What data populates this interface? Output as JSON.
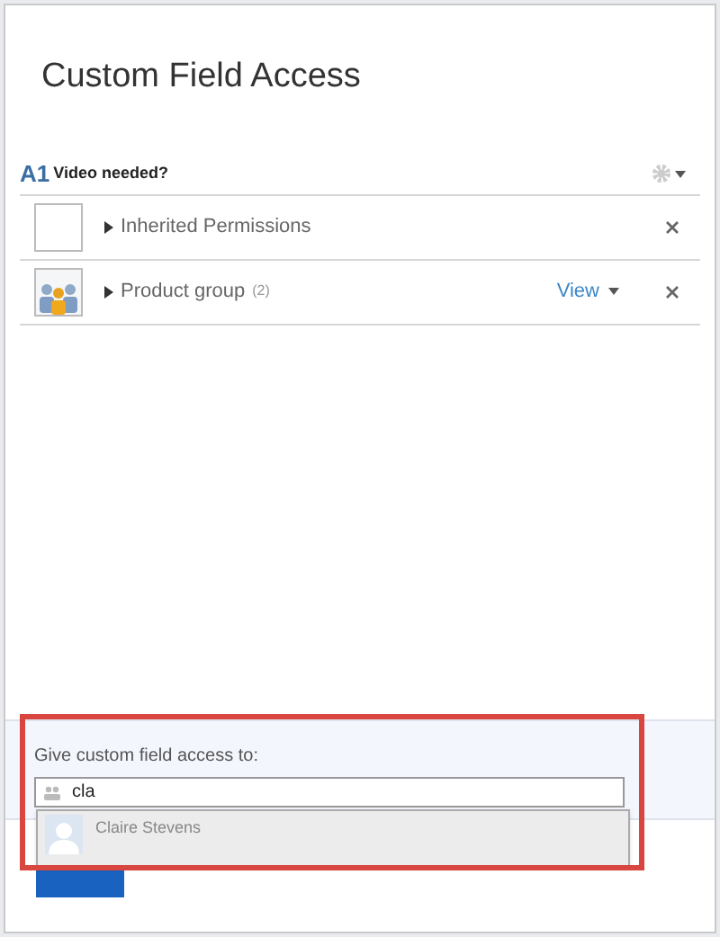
{
  "dialog": {
    "title": "Custom Field Access"
  },
  "field": {
    "badge": "A1",
    "name": "Video needed?"
  },
  "permissions": [
    {
      "kind": "blank",
      "label": "Inherited Permissions",
      "expanded": false
    },
    {
      "kind": "group",
      "label": "Product group",
      "count": "(2)",
      "access": "View",
      "expanded": false
    }
  ],
  "access_form": {
    "label": "Give custom field access to:",
    "value": "cla",
    "suggestions": [
      {
        "name": "Claire Stevens"
      }
    ]
  }
}
